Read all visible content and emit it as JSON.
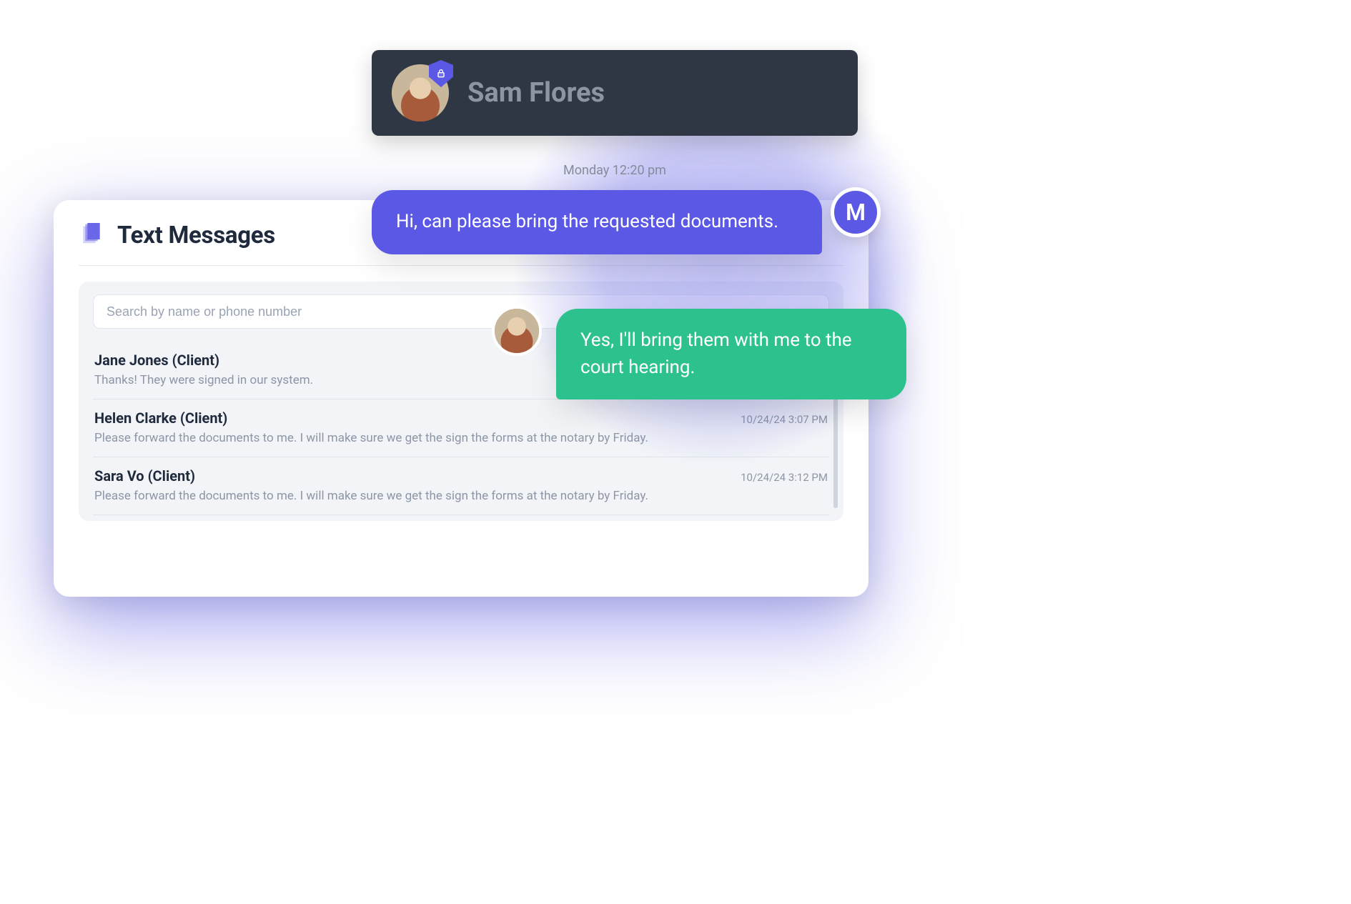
{
  "contact": {
    "name": "Sam Flores",
    "badge_icon": "lock-shield-icon"
  },
  "chat": {
    "timestamp": "Monday 12:20 pm",
    "outgoing_text": "Hi, can please bring the requested documents.",
    "outgoing_avatar_initial": "M",
    "incoming_text": "Yes, I'll bring them with me to the court hearing."
  },
  "panel": {
    "title": "Text Messages",
    "search_placeholder": "Search by name or phone number"
  },
  "threads": [
    {
      "name": "Jane Jones (Client)",
      "time": "",
      "preview": "Thanks! They were signed in our system."
    },
    {
      "name": "Helen Clarke (Client)",
      "time": "10/24/24 3:07 PM",
      "preview": "Please forward the documents to me. I will make sure we get the sign the forms at the notary by Friday."
    },
    {
      "name": "Sara Vo (Client)",
      "time": "10/24/24 3:12 PM",
      "preview": "Please forward the documents to me. I will make sure we get the sign the forms at the notary by Friday."
    }
  ]
}
